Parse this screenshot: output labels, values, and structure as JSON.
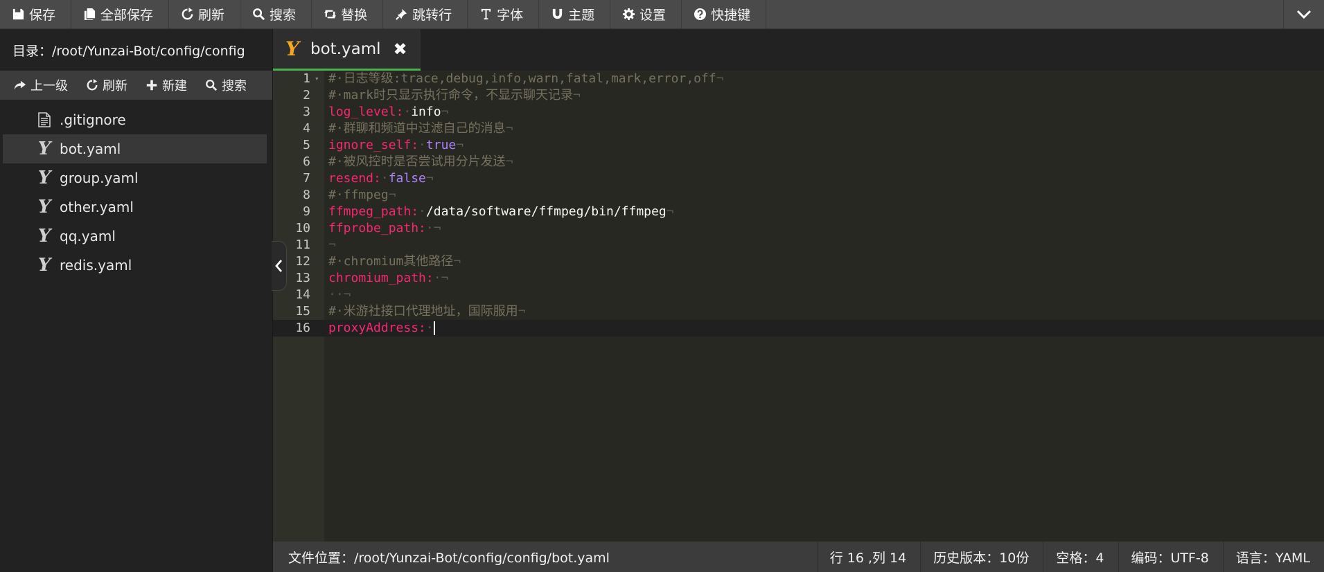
{
  "toolbar": {
    "items": [
      {
        "label": "保存",
        "icon": "floppy-icon"
      },
      {
        "label": "全部保存",
        "icon": "files-icon"
      },
      {
        "label": "刷新",
        "icon": "refresh-icon"
      },
      {
        "label": "搜索",
        "icon": "search-icon"
      },
      {
        "label": "替换",
        "icon": "retweet-icon"
      },
      {
        "label": "跳转行",
        "icon": "pin-icon"
      },
      {
        "label": "字体",
        "icon": "text-icon"
      },
      {
        "label": "主题",
        "icon": "magnet-icon"
      },
      {
        "label": "设置",
        "icon": "gear-icon"
      },
      {
        "label": "快捷键",
        "icon": "question-icon"
      }
    ]
  },
  "sidebar": {
    "dir_label": "目录：/root/Yunzai-Bot/config/config",
    "tools": [
      {
        "label": "上一级",
        "icon": "share-icon"
      },
      {
        "label": "刷新",
        "icon": "refresh-icon"
      },
      {
        "label": "新建",
        "icon": "plus-icon"
      },
      {
        "label": "搜索",
        "icon": "search-icon"
      }
    ],
    "files": [
      {
        "name": ".gitignore",
        "type": "file"
      },
      {
        "name": "bot.yaml",
        "type": "yaml"
      },
      {
        "name": "group.yaml",
        "type": "yaml"
      },
      {
        "name": "other.yaml",
        "type": "yaml"
      },
      {
        "name": "qq.yaml",
        "type": "yaml"
      },
      {
        "name": "redis.yaml",
        "type": "yaml"
      }
    ],
    "active_file": "bot.yaml"
  },
  "tab": {
    "label": "bot.yaml",
    "close": "✖"
  },
  "editor": {
    "current_line": 16,
    "lines": [
      {
        "n": "1",
        "tokens": [
          {
            "t": "#·日志等级:trace,debug,info,warn,fatal,mark,error,off",
            "c": "comment"
          },
          {
            "t": "¬",
            "c": "inv"
          }
        ]
      },
      {
        "n": "2",
        "tokens": [
          {
            "t": "#·mark时只显示执行命令，不显示聊天记录",
            "c": "comment"
          },
          {
            "t": "¬",
            "c": "inv"
          }
        ]
      },
      {
        "n": "3",
        "tokens": [
          {
            "t": "log_level:",
            "c": "key"
          },
          {
            "t": "·",
            "c": "inv"
          },
          {
            "t": "info",
            "c": "val"
          },
          {
            "t": "¬",
            "c": "inv"
          }
        ]
      },
      {
        "n": "4",
        "tokens": [
          {
            "t": "#·群聊和频道中过滤自己的消息",
            "c": "comment"
          },
          {
            "t": "¬",
            "c": "inv"
          }
        ]
      },
      {
        "n": "5",
        "tokens": [
          {
            "t": "ignore_self:",
            "c": "key"
          },
          {
            "t": "·",
            "c": "inv"
          },
          {
            "t": "true",
            "c": "bool"
          },
          {
            "t": "¬",
            "c": "inv"
          }
        ]
      },
      {
        "n": "6",
        "tokens": [
          {
            "t": "#·被风控时是否尝试用分片发送",
            "c": "comment"
          },
          {
            "t": "¬",
            "c": "inv"
          }
        ]
      },
      {
        "n": "7",
        "tokens": [
          {
            "t": "resend:",
            "c": "key"
          },
          {
            "t": "·",
            "c": "inv"
          },
          {
            "t": "false",
            "c": "bool"
          },
          {
            "t": "¬",
            "c": "inv"
          }
        ]
      },
      {
        "n": "8",
        "tokens": [
          {
            "t": "#·ffmpeg",
            "c": "comment"
          },
          {
            "t": "¬",
            "c": "inv"
          }
        ]
      },
      {
        "n": "9",
        "tokens": [
          {
            "t": "ffmpeg_path:",
            "c": "key"
          },
          {
            "t": "·",
            "c": "inv"
          },
          {
            "t": "/data/software/ffmpeg/bin/ffmpeg",
            "c": "val"
          },
          {
            "t": "¬",
            "c": "inv"
          }
        ]
      },
      {
        "n": "10",
        "tokens": [
          {
            "t": "ffprobe_path:",
            "c": "key"
          },
          {
            "t": "·¬",
            "c": "inv"
          }
        ]
      },
      {
        "n": "11",
        "tokens": [
          {
            "t": "¬",
            "c": "inv"
          }
        ]
      },
      {
        "n": "12",
        "tokens": [
          {
            "t": "#·chromium其他路径",
            "c": "comment"
          },
          {
            "t": "¬",
            "c": "inv"
          }
        ]
      },
      {
        "n": "13",
        "tokens": [
          {
            "t": "chromium_path:",
            "c": "key"
          },
          {
            "t": "·¬",
            "c": "inv"
          }
        ]
      },
      {
        "n": "14",
        "tokens": [
          {
            "t": "··¬",
            "c": "inv"
          }
        ]
      },
      {
        "n": "15",
        "tokens": [
          {
            "t": "#·米游社接口代理地址，国际服用",
            "c": "comment"
          },
          {
            "t": "¬",
            "c": "inv"
          }
        ]
      },
      {
        "n": "16",
        "tokens": [
          {
            "t": "proxyAddress:",
            "c": "key"
          },
          {
            "t": "·",
            "c": "inv"
          }
        ]
      }
    ]
  },
  "status": {
    "file": "文件位置：/root/Yunzai-Bot/config/config/bot.yaml",
    "position": "行 16 ,列 14",
    "history": "历史版本：10份",
    "indent": "空格：4",
    "encoding": "编码：UTF-8",
    "language": "语言：YAML"
  },
  "colors": {
    "comment": "#75715e",
    "key": "#f92672",
    "value": "#f8f8f2",
    "bool": "#ae81ff",
    "tab_underline": "#4caf50",
    "yaml_tab_icon": "#f5a623"
  }
}
